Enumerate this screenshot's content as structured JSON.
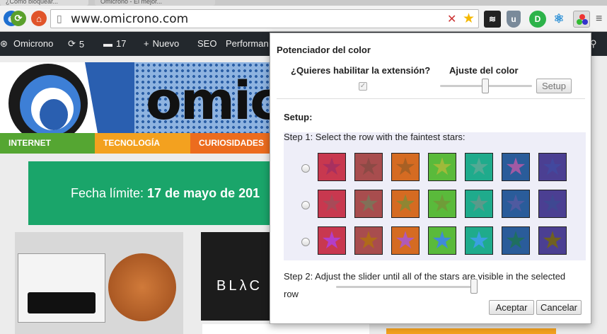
{
  "browser": {
    "tabs": [
      {
        "title": "¿Cómo bloquear..."
      },
      {
        "title": "Omicrono - El mejor..."
      }
    ],
    "url": "www.omicrono.com"
  },
  "wp_admin": {
    "site": "Omicrono",
    "updates": "5",
    "comments": "17",
    "new": "Nuevo",
    "seo": "SEO",
    "perf": "Performan"
  },
  "site": {
    "logo": "omicr",
    "menu": [
      "INTERNET",
      "TECNOLOGÍA",
      "CURIOSIDADES"
    ],
    "deadline_label": "Fecha límite: ",
    "deadline_date": "17 de mayo de 201",
    "black_text": "BLλC"
  },
  "popup": {
    "title": "Potenciador del color",
    "enable_question": "¿Quieres habilitar la extensión?",
    "adjust_label": "Ajuste del color",
    "setup_button": "Setup",
    "setup_title": "Setup:",
    "step1": "Step 1: Select the row with the faintest stars:",
    "step2": "Step 2: Adjust the slider until all of the stars are visible in the selected row",
    "accept": "Aceptar",
    "cancel": "Cancelar",
    "swatch_colors": [
      "#c8384f",
      "#a84d4e",
      "#d56b22",
      "#5aba3b",
      "#1fab8c",
      "#2a5c9a",
      "#4b3f92"
    ],
    "star_rows": [
      [
        "#a8305f",
        "#8c4a45",
        "#a86024",
        "#9fba3a",
        "#52aa94",
        "#a15aa4",
        "#42489e"
      ],
      [
        "#a84a58",
        "#807058",
        "#8f8633",
        "#6f9c38",
        "#5a9a8a",
        "#4f5aa0",
        "#3f4892"
      ],
      [
        "#b33ec8",
        "#b06a1a",
        "#b05ab8",
        "#3f8ad8",
        "#3aa0e0",
        "#1f6f60",
        "#6f6020"
      ]
    ]
  }
}
